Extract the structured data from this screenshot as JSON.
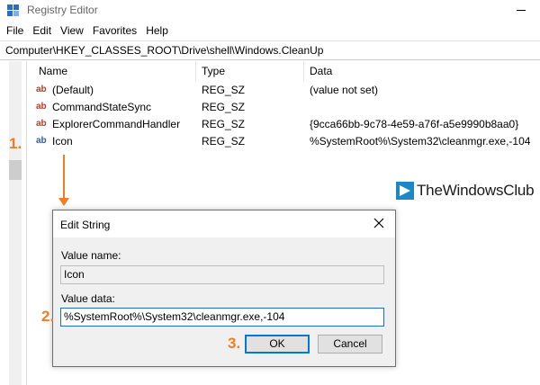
{
  "window": {
    "title": "Registry Editor"
  },
  "menu": [
    "File",
    "Edit",
    "View",
    "Favorites",
    "Help"
  ],
  "address": "Computer\\HKEY_CLASSES_ROOT\\Drive\\shell\\Windows.CleanUp",
  "columns": {
    "name": "Name",
    "type": "Type",
    "data": "Data"
  },
  "values": [
    {
      "name": "(Default)",
      "type": "REG_SZ",
      "data": "(value not set)"
    },
    {
      "name": "CommandStateSync",
      "type": "REG_SZ",
      "data": ""
    },
    {
      "name": "ExplorerCommandHandler",
      "type": "REG_SZ",
      "data": "{9cca66bb-9c78-4e59-a76f-a5e9990b8aa0}"
    },
    {
      "name": "Icon",
      "type": "REG_SZ",
      "data": "%SystemRoot%\\System32\\cleanmgr.exe,-104"
    }
  ],
  "icons": {
    "value_icon": "string-value-icon",
    "text": "ab"
  },
  "watermark": {
    "text": "TheWindowsClub"
  },
  "steps": [
    "1.",
    "2.",
    "3."
  ],
  "dialog": {
    "title": "Edit String",
    "value_name_label": "Value name:",
    "value_name": "Icon",
    "value_data_label": "Value data:",
    "value_data": "%SystemRoot%\\System32\\cleanmgr.exe,-104",
    "ok_label": "OK",
    "cancel_label": "Cancel"
  },
  "colors": {
    "accent": "#f07d22",
    "focus": "#0078d7"
  }
}
